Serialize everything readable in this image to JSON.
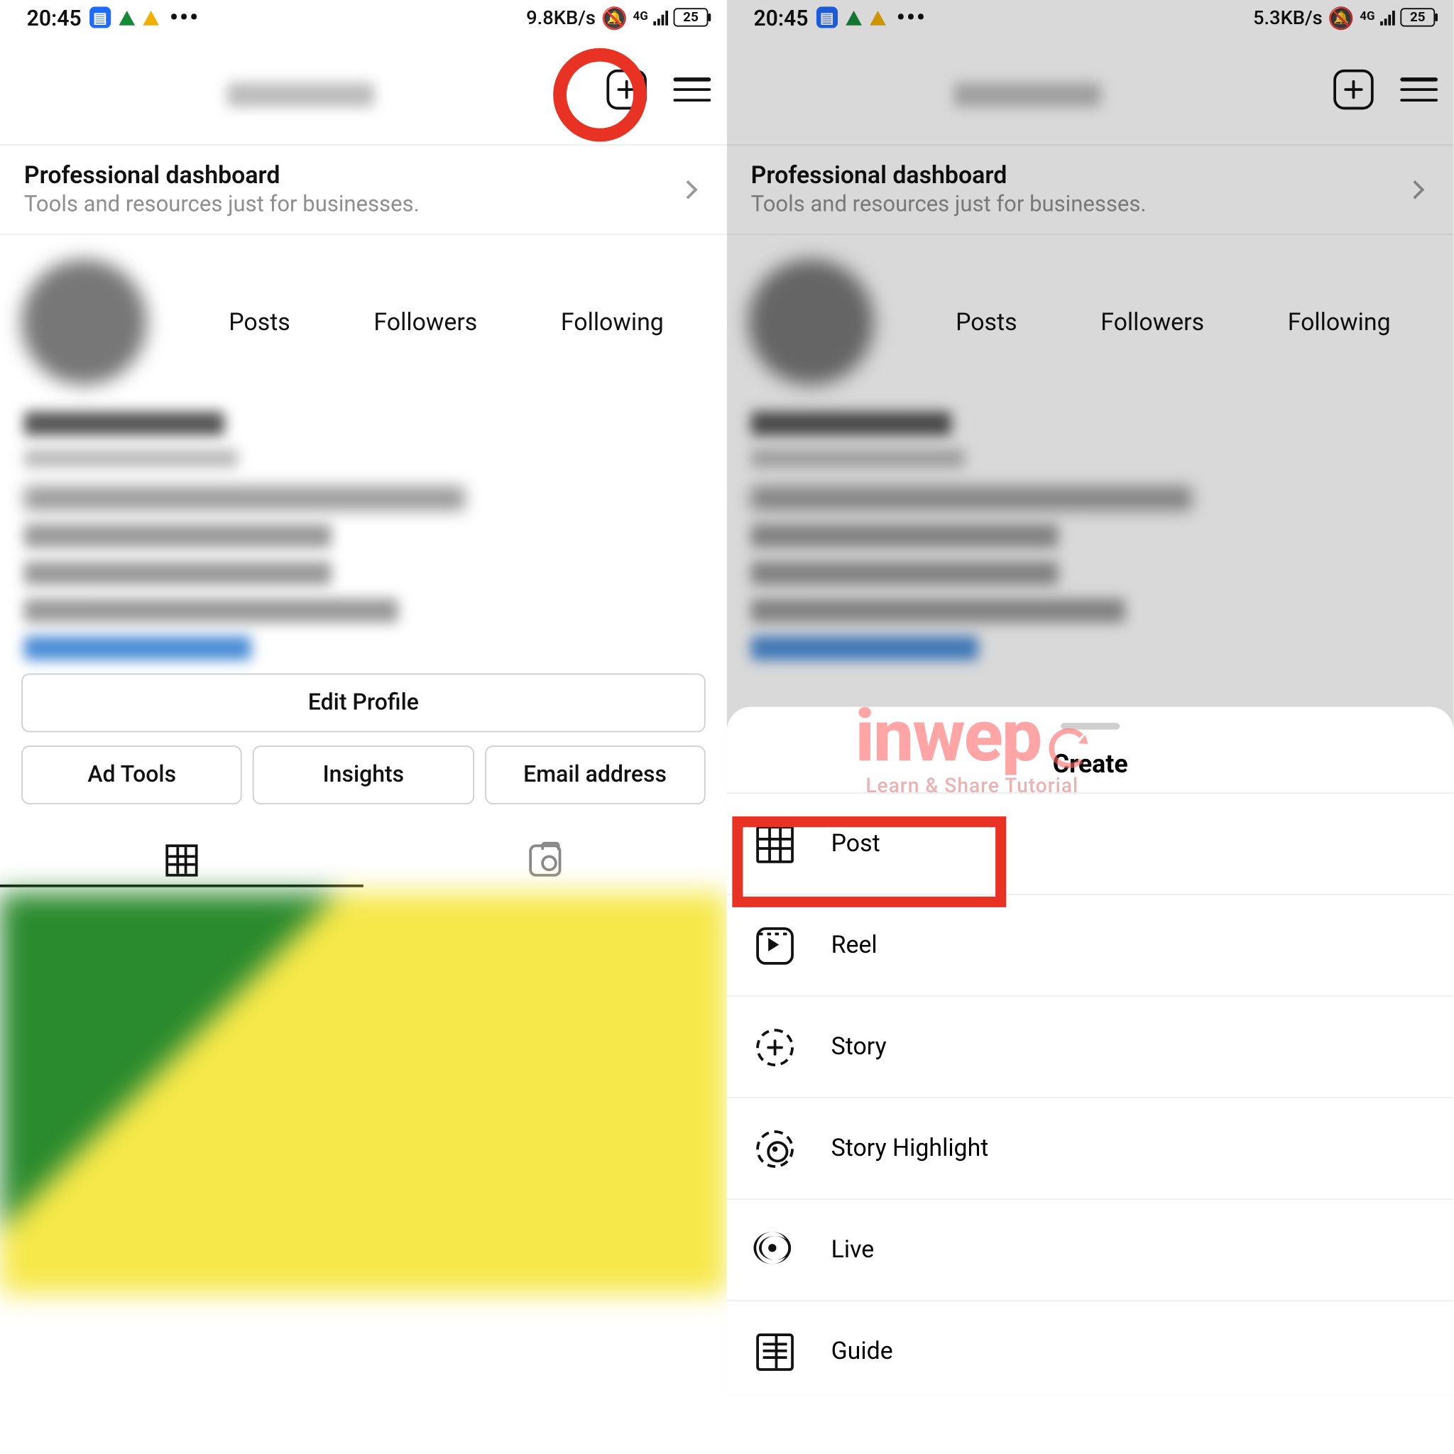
{
  "statusbar": {
    "time": "20:45",
    "net_left": "9.8KB/s",
    "net_right": "5.3KB/s",
    "signal": "4G",
    "battery": "25",
    "dots": "•••"
  },
  "dashboard": {
    "title": "Professional dashboard",
    "subtitle": "Tools and resources just for businesses."
  },
  "stats": {
    "posts": "Posts",
    "followers": "Followers",
    "following": "Following"
  },
  "buttons": {
    "edit": "Edit Profile",
    "ad": "Ad Tools",
    "insights": "Insights",
    "email": "Email address"
  },
  "sheet": {
    "title": "Create",
    "items": {
      "post": "Post",
      "reel": "Reel",
      "story": "Story",
      "highlight": "Story Highlight",
      "live": "Live",
      "guide": "Guide"
    }
  },
  "watermark": {
    "brand": "inwep",
    "tag": "Learn & Share Tutorial"
  }
}
